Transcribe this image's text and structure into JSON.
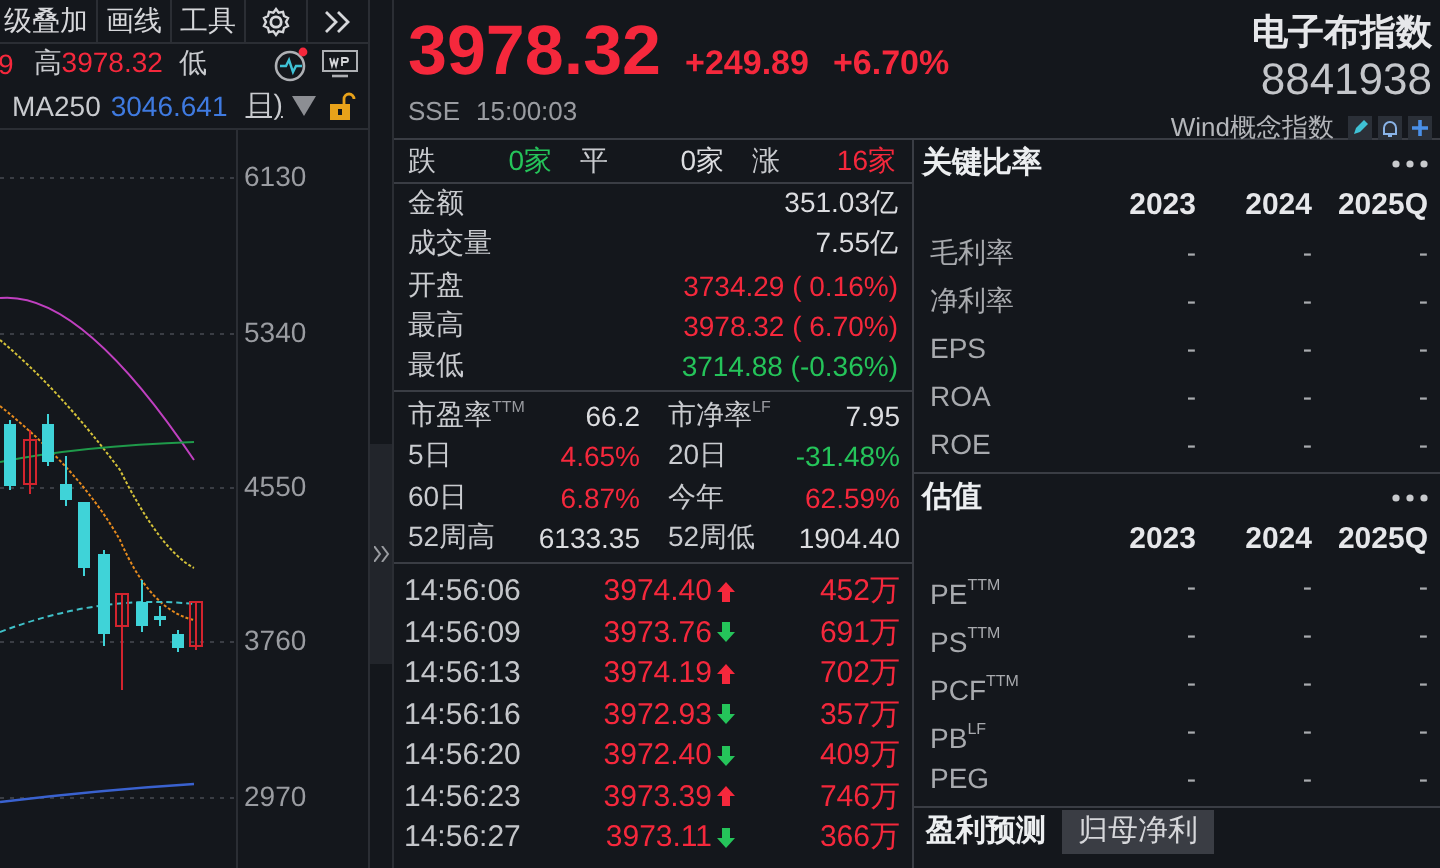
{
  "chart_panel": {
    "toolbar": [
      {
        "label": "级叠加"
      },
      {
        "label": "画线"
      },
      {
        "label": "工具"
      }
    ],
    "info": {
      "prev_tail": "9",
      "high_label": "高",
      "high_value": "3978.32",
      "low_label": "低"
    },
    "ma": {
      "label": "MA250",
      "value": "3046.641",
      "period_tail": "日)"
    },
    "axis_labels": [
      "6130",
      "5340",
      "4550",
      "3760",
      "2970"
    ]
  },
  "quote": {
    "price": "3978.32",
    "change": "+249.89",
    "change_pct": "+6.70%",
    "exchange": "SSE",
    "time": "15:00:03",
    "name": "电子布指数",
    "code": "8841938",
    "category": "Wind概念指数",
    "breadth": [
      {
        "label": "跌",
        "value": "0家",
        "color": "#25c45a"
      },
      {
        "label": "平",
        "value": "0家",
        "color": "#dcdde0"
      },
      {
        "label": "涨",
        "value": "16家",
        "color": "#f5283c"
      }
    ],
    "stats": [
      {
        "label": "金额",
        "value": "351.03亿",
        "color": "#dcdde0"
      },
      {
        "label": "成交量",
        "value": "7.55亿",
        "color": "#dcdde0"
      },
      {
        "label": "开盘",
        "value": "3734.29 ( 0.16%)",
        "color": "#f5283c"
      },
      {
        "label": "最高",
        "value": "3978.32 ( 6.70%)",
        "color": "#f5283c"
      },
      {
        "label": "最低",
        "value": "3714.88 (-0.36%)",
        "color": "#25c45a"
      }
    ],
    "metrics": [
      {
        "label": "市盈率$^{TTM}$",
        "value": "66.2",
        "color": "#dcdde0"
      },
      {
        "label": "市净率$^{LF}$",
        "value": "7.95",
        "color": "#dcdde0"
      },
      {
        "label": "5日",
        "value": "4.65%",
        "color": "#f5283c"
      },
      {
        "label": "20日",
        "value": "-31.48%",
        "color": "#25c45a"
      },
      {
        "label": "60日",
        "value": "6.87%",
        "color": "#f5283c"
      },
      {
        "label": "今年",
        "value": "62.59%",
        "color": "#f5283c"
      },
      {
        "label": "52周高",
        "value": "6133.35",
        "color": "#dcdde0"
      },
      {
        "label": "52周低",
        "value": "1904.40",
        "color": "#dcdde0"
      }
    ],
    "trades": [
      {
        "time": "14:56:06",
        "price": "3974.40",
        "uptick": true,
        "volume": "452万"
      },
      {
        "time": "14:56:09",
        "price": "3973.76",
        "uptick": false,
        "volume": "691万"
      },
      {
        "time": "14:56:13",
        "price": "3974.19",
        "uptick": true,
        "volume": "702万"
      },
      {
        "time": "14:56:16",
        "price": "3972.93",
        "uptick": false,
        "volume": "357万"
      },
      {
        "time": "14:56:20",
        "price": "3972.40",
        "uptick": false,
        "volume": "409万"
      },
      {
        "time": "14:56:23",
        "price": "3973.39",
        "uptick": true,
        "volume": "746万"
      },
      {
        "time": "14:56:27",
        "price": "3973.11",
        "uptick": false,
        "volume": "366万"
      }
    ]
  },
  "ratios": {
    "title": "关键比率",
    "columns": [
      "2023",
      "2024",
      "2025Q"
    ],
    "rows": [
      {
        "label": "毛利率",
        "values": [
          "-",
          "-",
          "-"
        ]
      },
      {
        "label": "净利率",
        "values": [
          "-",
          "-",
          "-"
        ]
      },
      {
        "label": "EPS",
        "values": [
          "-",
          "-",
          "-"
        ]
      },
      {
        "label": "ROA",
        "values": [
          "-",
          "-",
          "-"
        ]
      },
      {
        "label": "ROE",
        "values": [
          "-",
          "-",
          "-"
        ]
      }
    ]
  },
  "valuation": {
    "title": "估值",
    "columns": [
      "2023",
      "2024",
      "2025Q"
    ],
    "rows": [
      {
        "label": "PE$^{TTM}$",
        "values": [
          "-",
          "-",
          "-"
        ]
      },
      {
        "label": "PS$^{TTM}$",
        "values": [
          "-",
          "-",
          "-"
        ]
      },
      {
        "label": "PCF$^{TTM}$",
        "values": [
          "-",
          "-",
          "-"
        ]
      },
      {
        "label": "PB$^{LF}$",
        "values": [
          "-",
          "-",
          "-"
        ]
      },
      {
        "label": "PEG",
        "values": [
          "-",
          "-",
          "-"
        ]
      }
    ]
  },
  "forecast": {
    "title": "盈利预测",
    "tabs": [
      {
        "label": "归母净利",
        "selected": true
      }
    ]
  }
}
